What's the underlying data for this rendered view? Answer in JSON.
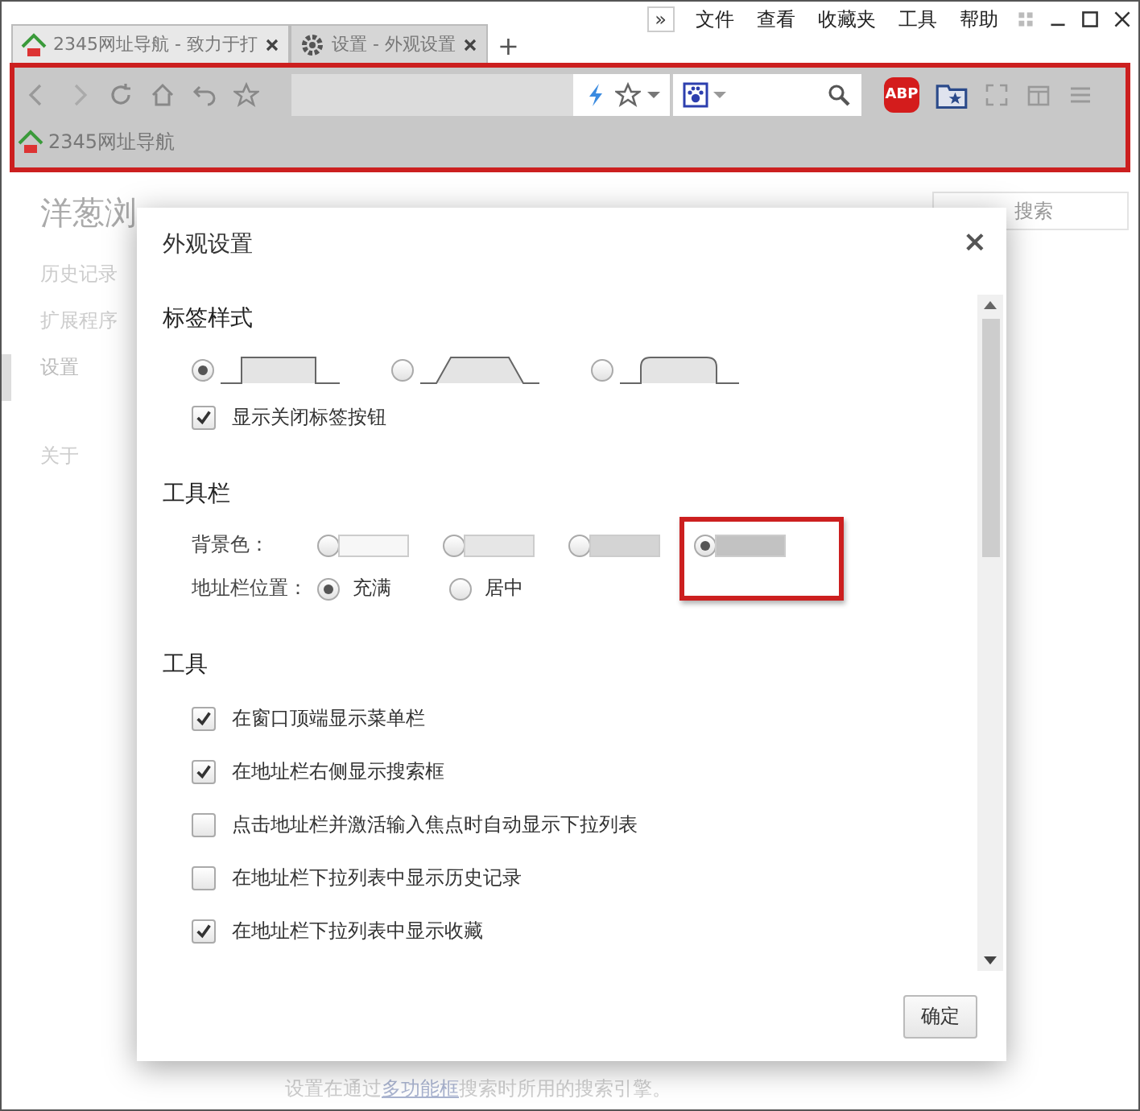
{
  "title_bar": {
    "overflow": "»",
    "menu": [
      "文件",
      "查看",
      "收藏夹",
      "工具",
      "帮助"
    ],
    "new_tab": "+"
  },
  "tabs": [
    {
      "title": "2345网址导航 - 致力于打",
      "selected": false,
      "kind": "site"
    },
    {
      "title": "设置 - 外观设置",
      "selected": true,
      "kind": "settings"
    }
  ],
  "toolbar": {
    "highlighted": true,
    "adblock_badge": "ABP"
  },
  "bookmarks": [
    {
      "label": "2345网址导航"
    }
  ],
  "settings_page": {
    "brand": "洋葱浏",
    "nav": [
      {
        "label": "历史记录",
        "selected": false
      },
      {
        "label": "扩展程序",
        "selected": false
      },
      {
        "label": "设置",
        "selected": true
      },
      {
        "label": "关于",
        "selected": false
      }
    ],
    "search": {
      "placeholder": "搜索"
    },
    "footer": {
      "before": "设置在通过",
      "link": "多功能框",
      "after": "搜索时所用的搜索引擎。"
    }
  },
  "dialog": {
    "title": "外观设置",
    "close": "×",
    "tab_style": {
      "heading": "标签样式",
      "options": [
        {
          "kind": "square",
          "selected": true
        },
        {
          "kind": "trapezoid",
          "selected": false
        },
        {
          "kind": "rounded",
          "selected": false
        }
      ],
      "show_close_button": {
        "label": "显示关闭标签按钮",
        "checked": true
      }
    },
    "toolbar_section": {
      "heading": "工具栏",
      "background": {
        "label": "背景色：",
        "options": [
          {
            "color": "#f7f7f7",
            "selected": false,
            "highlighted": false
          },
          {
            "color": "#e6e6e6",
            "selected": false,
            "highlighted": false
          },
          {
            "color": "#d4d4d4",
            "selected": false,
            "highlighted": false
          },
          {
            "color": "#c2c2c2",
            "selected": true,
            "highlighted": true
          }
        ]
      },
      "address_position": {
        "label": "地址栏位置：",
        "options": [
          {
            "label": "充满",
            "selected": true
          },
          {
            "label": "居中",
            "selected": false
          }
        ]
      }
    },
    "tools": {
      "heading": "工具",
      "options": [
        {
          "label": "在窗口顶端显示菜单栏",
          "checked": true
        },
        {
          "label": "在地址栏右侧显示搜索框",
          "checked": true
        },
        {
          "label": "点击地址栏并激活输入焦点时自动显示下拉列表",
          "checked": false
        },
        {
          "label": "在地址栏下拉列表中显示历史记录",
          "checked": false
        },
        {
          "label": "在地址栏下拉列表中显示收藏",
          "checked": true
        }
      ]
    },
    "ok_button": "确定"
  }
}
